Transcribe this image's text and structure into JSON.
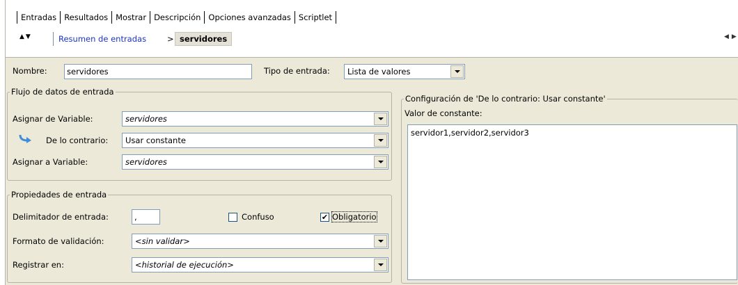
{
  "tabs": [
    "Entradas",
    "Resultados",
    "Mostrar",
    "Descripción",
    "Opciones avanzadas",
    "Scriptlet"
  ],
  "breadcrumb": {
    "parent": "Resumen de entradas",
    "separator": ">",
    "current": "servidores"
  },
  "form": {
    "name_label": "Nombre:",
    "name_value": "servidores",
    "input_type_label": "Tipo de entrada:",
    "input_type_value": "Lista de valores"
  },
  "flow": {
    "title": "Flujo de datos de entrada",
    "assign_from_label": "Asignar de Variable:",
    "assign_from_value": "servidores",
    "otherwise_label": "De lo contrario:",
    "otherwise_value": "Usar constante",
    "assign_to_label": "Asignar a Variable:",
    "assign_to_value": "servidores"
  },
  "props": {
    "title": "Propiedades de entrada",
    "delimiter_label": "Delimitador de entrada:",
    "delimiter_value": ",",
    "fuzzy_label": "Confuso",
    "fuzzy_checked": false,
    "required_label": "Obligatorio",
    "required_checked": true,
    "validation_label": "Formato de validación:",
    "validation_value": "<sin validar>",
    "log_label": "Registrar en:",
    "log_value": "<historial de ejecución>"
  },
  "config": {
    "title": "Configuración de 'De lo contrario: Usar constante'",
    "constant_label": "Valor de constante:",
    "constant_value": "servidor1,servidor2,servidor3"
  },
  "icons": {
    "up": "▲",
    "down": "▼",
    "left": "◀",
    "right": "▶",
    "close": "✕",
    "check": "✔"
  }
}
